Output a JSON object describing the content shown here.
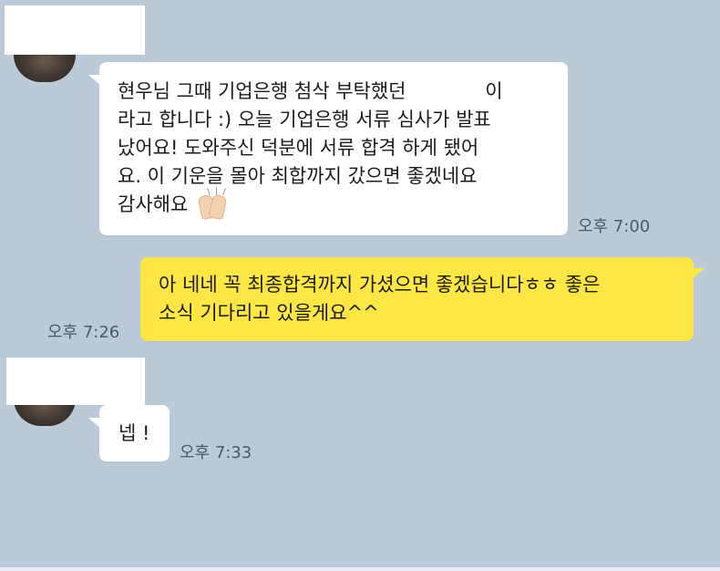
{
  "messages": [
    {
      "from": "other",
      "lines": [
        "현우님 그때 기업은행 첨삭 부탁했던             이",
        "라고 합니다 :) 오늘 기업은행 서류 심사가 발표",
        "났어요! 도와주신 덕분에 서류 합격 하게 됐어",
        "요. 이 기운을 몰아 최합까지 갔으면 좋겠네요",
        "감사해요"
      ],
      "emoji": "raised-hands",
      "time": "오후 7:00"
    },
    {
      "from": "me",
      "lines": [
        "아 네네 꼭 최종합격까지 가셨으면 좋겠습니다ㅎㅎ 좋은",
        "소식 기다리고 있을게요^^"
      ],
      "time": "오후 7:26"
    },
    {
      "from": "other",
      "lines": [
        "넵 !"
      ],
      "time": "오후 7:33"
    }
  ],
  "colors": {
    "background": "#bacad8",
    "incoming_bubble": "#ffffff",
    "outgoing_bubble": "#fde744",
    "timestamp": "#4f5a65"
  }
}
